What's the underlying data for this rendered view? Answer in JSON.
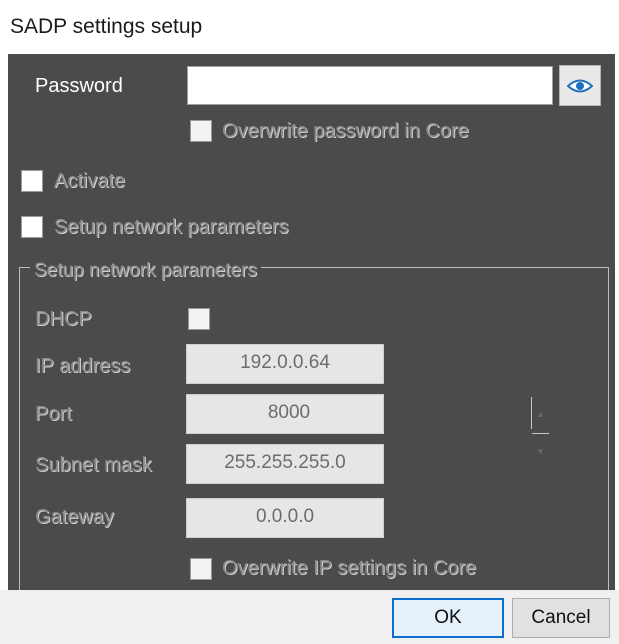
{
  "window": {
    "title": "SADP settings setup"
  },
  "credentials": {
    "password_label": "Password",
    "password_value": "",
    "show_password_icon": "eye-icon",
    "overwrite_password_label": "Overwrite password in Core",
    "overwrite_password_checked": false
  },
  "options": {
    "activate_label": "Activate",
    "activate_checked": false,
    "setup_network_label": "Setup network parameters",
    "setup_network_checked": false
  },
  "network": {
    "group_title": "Setup network parameters",
    "dhcp_label": "DHCP",
    "dhcp_checked": false,
    "ip_label": "IP address",
    "ip_value": "192.0.0.64",
    "port_label": "Port",
    "port_value": "8000",
    "subnet_label": "Subnet mask",
    "subnet_value": "255.255.255.0",
    "gateway_label": "Gateway",
    "gateway_value": "0.0.0.0",
    "overwrite_ip_label": "Overwrite IP settings in Core",
    "overwrite_ip_checked": false
  },
  "footer": {
    "ok_label": "OK",
    "cancel_label": "Cancel"
  },
  "colors": {
    "panel_bg": "#4b4b4b",
    "footer_bg": "#f0f0f0",
    "default_button_border": "#0a6fd1",
    "disabled_text": "#8a8a8a"
  }
}
